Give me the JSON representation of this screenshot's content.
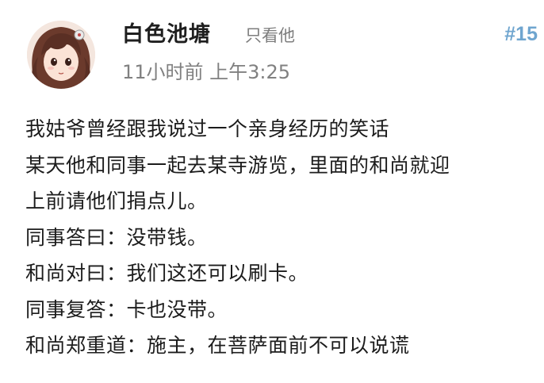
{
  "post": {
    "username": "白色池塘",
    "only_him_label": "只看他",
    "floor": "#15",
    "timestamp": "11小时前 上午3:25",
    "avatar_icon": "anime-girl-avatar-icon",
    "lines": [
      "我姑爷曾经跟我说过一个亲身经历的笑话",
      "某天他和同事一起去某寺游览，里面的和尚就迎",
      "上前请他们捐点儿。",
      "同事答曰：没带钱。",
      "和尚对曰：我们这还可以刷卡。",
      "同事复答：卡也没带。",
      "和尚郑重道：施主，在菩萨面前不可以说谎"
    ]
  },
  "colors": {
    "floor": "#6fa5cf",
    "meta": "#808080",
    "text": "#1c1c1c"
  }
}
